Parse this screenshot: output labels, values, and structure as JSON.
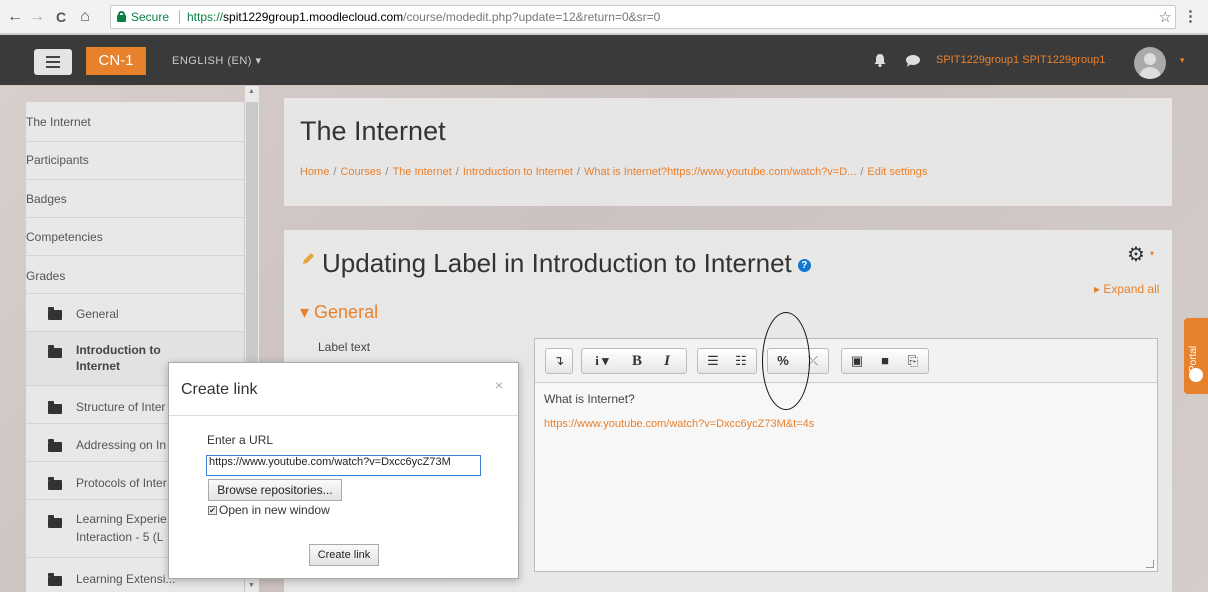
{
  "browser": {
    "back": "←",
    "forward": "→",
    "reload": "C",
    "home": "⌂",
    "secure_label": "Secure",
    "url_scheme": "https://",
    "url_host": "spit1229group1.moodlecloud.com",
    "url_path": "/course/modedit.php?update=12&return=0&sr=0",
    "star": "☆",
    "menu": "⋮"
  },
  "navbar": {
    "brand": "CN-1",
    "language": "ENGLISH (EN) ▾",
    "username": "SPIT1229group1 SPIT1229group1",
    "user_caret": "▾",
    "accent": "#e8812c"
  },
  "sidebar": {
    "items": [
      {
        "label": "The Internet"
      },
      {
        "label": "Participants"
      },
      {
        "label": "Badges"
      },
      {
        "label": "Competencies"
      },
      {
        "label": "Grades"
      },
      {
        "label": "General",
        "icon": "folder-icon"
      },
      {
        "label": "Introduction to",
        "label2": "Internet",
        "icon": "folder-icon"
      },
      {
        "label": "Structure of Inter",
        "icon": "folder-icon"
      },
      {
        "label": "Addressing on In",
        "icon": "folder-icon"
      },
      {
        "label": "Protocols of Inter",
        "icon": "folder-icon"
      },
      {
        "label": "Learning Experie",
        "label2": "Interaction - 5 (L",
        "icon": "folder-icon"
      },
      {
        "label": "Learning Extensi...",
        "icon": "folder-icon"
      }
    ]
  },
  "header": {
    "title": "The Internet",
    "breadcrumb": [
      "Home",
      "Courses",
      "The Internet",
      "Introduction to Internet",
      "What is Internet?https://www.youtube.com/watch?v=D...",
      "Edit settings"
    ],
    "separator": "/"
  },
  "main": {
    "title": "Updating Label in Introduction to Internet",
    "help": "?",
    "gear": "⚙",
    "gear_caret": "▾",
    "expand_all": "▸ Expand all",
    "section": "▾ General",
    "label_text": "Label text",
    "editor": {
      "toolbar": [
        {
          "name": "collapse-button",
          "glyph": "↴"
        },
        {
          "name": "style-button",
          "glyph": "i ▾"
        },
        {
          "name": "bold-button",
          "glyph": "B"
        },
        {
          "name": "italic-button",
          "glyph": "I"
        },
        {
          "name": "unordered-list-button",
          "glyph": "☰"
        },
        {
          "name": "ordered-list-button",
          "glyph": "☷"
        },
        {
          "name": "link-button",
          "glyph": "%"
        },
        {
          "name": "unlink-button",
          "glyph": "⤫"
        },
        {
          "name": "image-button",
          "glyph": "▣"
        },
        {
          "name": "media-button",
          "glyph": "■"
        },
        {
          "name": "manage-files-button",
          "glyph": "⎘"
        }
      ],
      "body_text": "What is Internet?",
      "body_link": "https://www.youtube.com/watch?v=Dxcc6ycZ73M&t=4s"
    }
  },
  "modal": {
    "title": "Create link",
    "close": "×",
    "url_label": "Enter a URL",
    "url_value": "https://www.youtube.com/watch?v=Dxcc6ycZ73M",
    "browse_label": "Browse repositories...",
    "new_window_label": "Open in new window",
    "new_window_checked": true,
    "create_label": "Create link"
  },
  "portal": {
    "label": "Portal"
  }
}
